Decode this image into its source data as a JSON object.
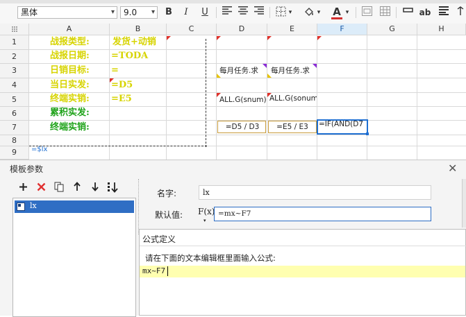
{
  "toolbar": {
    "font_name": "黑体",
    "font_size": "9.0",
    "bold": "B",
    "italic": "I",
    "underline": "U",
    "font_color_letter": "A",
    "ab_label": "ab",
    "colors": {
      "font_color_bar": "#d32f2f"
    }
  },
  "sheet": {
    "columns": [
      "A",
      "B",
      "C",
      "D",
      "E",
      "F",
      "G",
      "H"
    ],
    "selected_column": "F",
    "rows": [
      "1",
      "2",
      "3",
      "4",
      "5",
      "6",
      "7",
      "8",
      "9"
    ],
    "a_labels": [
      "战报类型:",
      "战报日期:",
      "日销目标:",
      "当日实发:",
      "终端实销:",
      "累积实发:",
      "终端实销:"
    ],
    "b_values": [
      "发货+动销",
      "=TODA",
      "=",
      "=D5",
      "=E5"
    ],
    "d3": "每月任务.求",
    "e3": "每月任务.求",
    "d5": "ALL.G(snum)",
    "e5": "ALL.G(sonum",
    "d7": "=D5 / D3",
    "e7": "=E5 / E3",
    "f7": "=IF(AND(D7",
    "a8": "=$lx",
    "colors": {
      "yellow_text": "#d7d400",
      "green_text": "#1fa31a",
      "selection": "#1f6fd1"
    }
  },
  "dialog": {
    "title": "模板参数",
    "params": [
      {
        "name": "lx"
      }
    ],
    "name_label": "名字:",
    "name_value": "lx",
    "default_label": "默认值:",
    "fx_label": "F(x)",
    "default_value": "=mx~F7",
    "formula": {
      "title": "公式定义",
      "instruction": "请在下面的文本编辑框里面输入公式:",
      "text": "mx~F7"
    }
  }
}
